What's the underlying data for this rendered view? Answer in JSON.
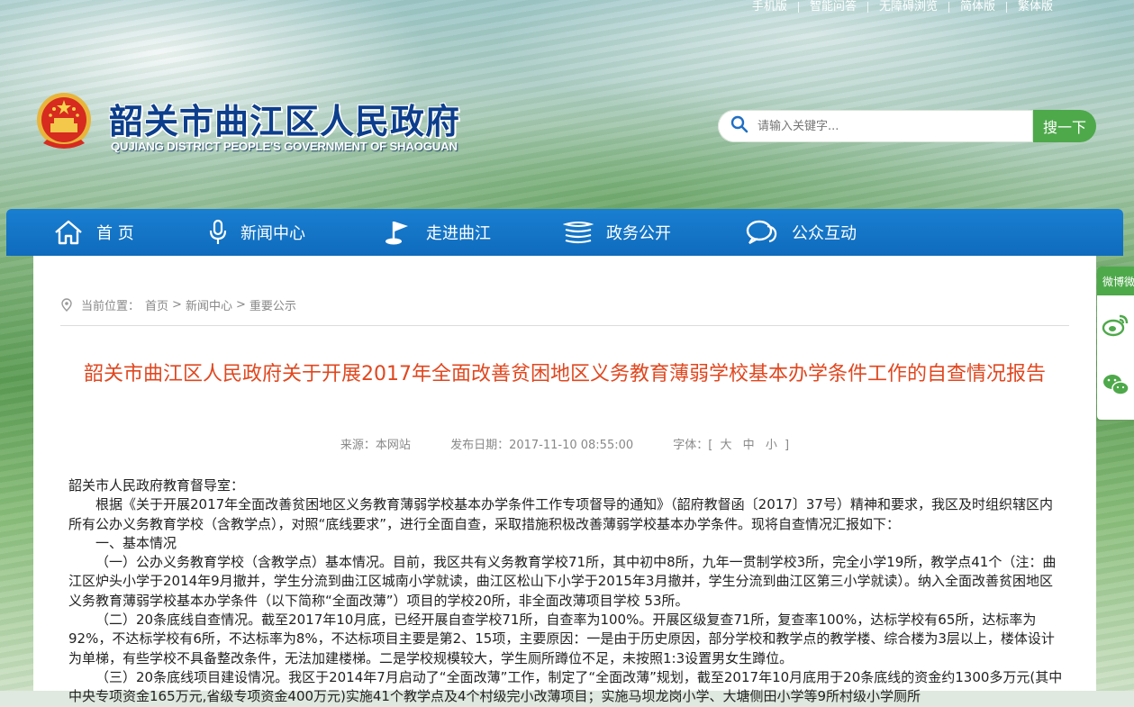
{
  "top_links": [
    "手机版",
    "智能问答",
    "无障碍浏览",
    "简体版",
    "繁体版"
  ],
  "site": {
    "title": "韶关市曲江区人民政府",
    "subtitle": "QUJIANG DISTRICT PEOPLE'S GOVERNMENT OF SHAOGUAN"
  },
  "search": {
    "placeholder": "请输入关键字...",
    "button": "搜一下"
  },
  "nav": [
    {
      "label": "首 页",
      "icon": "home-icon"
    },
    {
      "label": "新闻中心",
      "icon": "microphone-icon"
    },
    {
      "label": "走进曲江",
      "icon": "flag-icon"
    },
    {
      "label": "政务公开",
      "icon": "document-stack-icon"
    },
    {
      "label": "公众互动",
      "icon": "chat-bubble-icon"
    }
  ],
  "breadcrumb": {
    "prefix": "当前位置：",
    "items": [
      "首页",
      "新闻中心",
      "重要公示"
    ]
  },
  "article": {
    "title": "韶关市曲江区人民政府关于开展2017年全面改善贫困地区义务教育薄弱学校基本办学条件工作的自查情况报告",
    "source": "来源：本网站",
    "date": "发布日期：2017-11-10 08:55:00",
    "font_label": "字体：[",
    "font_large": "大",
    "font_medium": "中",
    "font_small": "小",
    "font_end": "]",
    "paragraphs": [
      "韶关市人民政府教育督导室：",
      "根据《关于开展2017年全面改善贫困地区义务教育薄弱学校基本办学条件工作专项督导的通知》（韶府教督函〔2017〕37号）精神和要求，我区及时组织辖区内所有公办义务教育学校（含教学点），对照“底线要求”，进行全面自查，采取措施积极改善薄弱学校基本办学条件。现将自查情况汇报如下：",
      "一、基本情况",
      "（一）公办义务教育学校（含教学点）基本情况。目前，我区共有义务教育学校71所，其中初中8所，九年一贯制学校3所，完全小学19所，教学点41个（注：曲江区炉头小学于2014年9月撤并，学生分流到曲江区城南小学就读，曲江区松山下小学于2015年3月撤并，学生分流到曲江区第三小学就读）。纳入全面改善贫困地区义务教育薄弱学校基本办学条件（以下简称“全面改薄”）项目的学校20所，非全面改薄项目学校 53所。",
      "（二）20条底线自查情况。截至2017年10月底，已经开展自查学校71所，自查率为100%。开展区级复查71所，复查率100%，达标学校有65所，达标率为92%，不达标学校有6所，不达标率为8%，不达标项目主要是第2、15项，主要原因：一是由于历史原因，部分学校和教学点的教学楼、综合楼为3层以上，楼体设计为单梯，有些学校不具备整改条件，无法加建楼梯。二是学校规模较大，学生厕所蹲位不足，未按照1:3设置男女生蹲位。",
      "（三）20条底线项目建设情况。我区于2014年7月启动了“全面改薄”工作，制定了“全面改薄”规划，截至2017年10月底用于20条底线的资金约1300多万元(其中中央专项资金165万元,省级专项资金400万元)实施41个教学点及4个村级完小改薄项目；实施马坝龙岗小学、大塘侧田小学等9所村级小学厕所"
    ]
  },
  "side_float": {
    "label": "微博微信",
    "items": [
      "weibo-icon",
      "wechat-icon"
    ]
  }
}
